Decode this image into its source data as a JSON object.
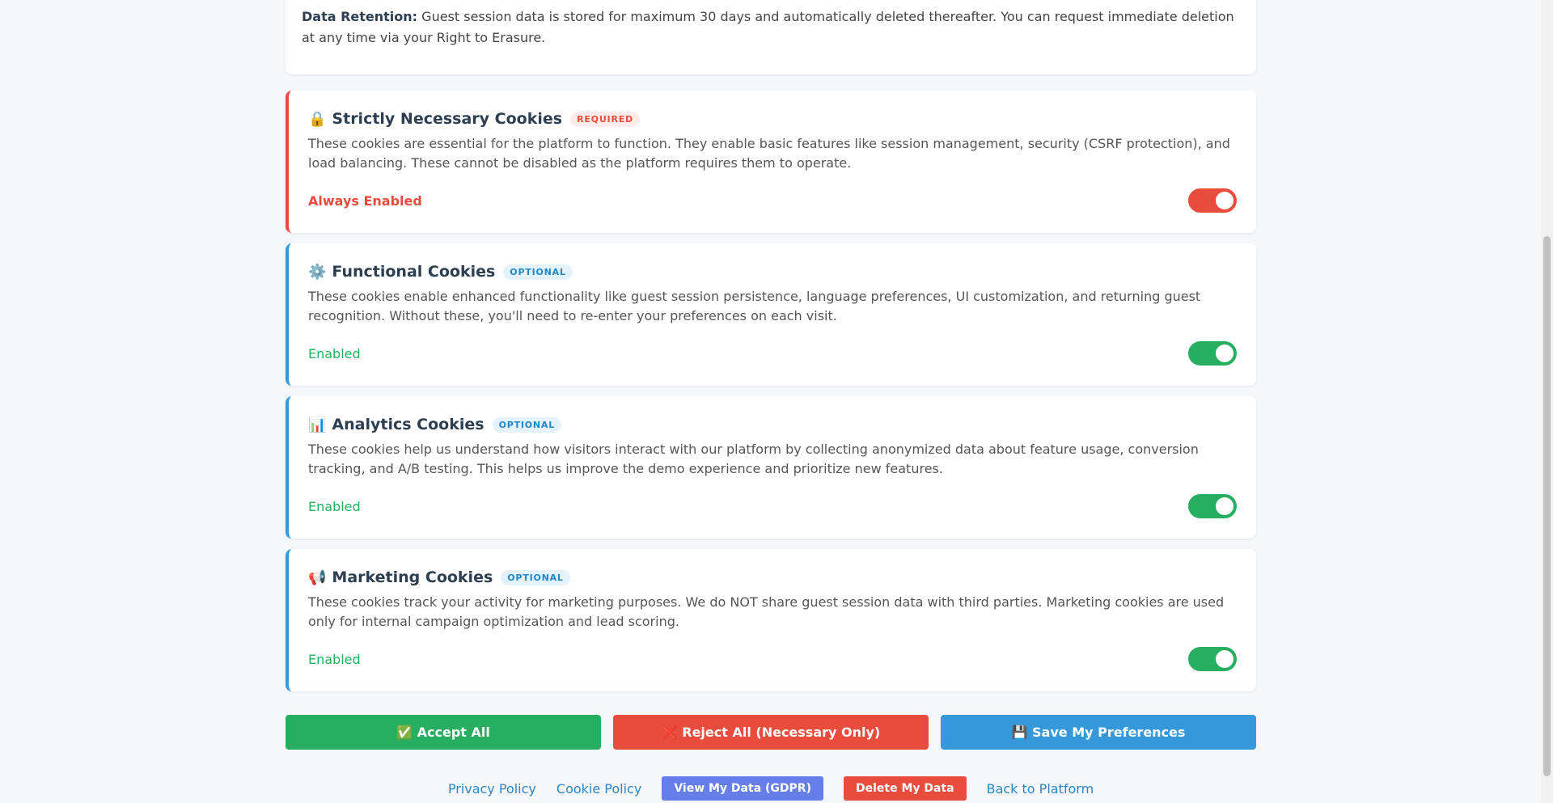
{
  "retention": {
    "label": "Data Retention:",
    "text": " Guest session data is stored for maximum 30 days and automatically deleted thereafter. You can request immediate deletion at any time via your Right to Erasure."
  },
  "cards": [
    {
      "icon": "🔒",
      "icon_name": "lock-icon",
      "title": "Strictly Necessary Cookies",
      "badge": "REQUIRED",
      "description": "These cookies are essential for the platform to function. They enable basic features like session management, security (CSRF protection), and load balancing. These cannot be disabled as the platform requires them to operate.",
      "status": "Always Enabled",
      "enabled": true
    },
    {
      "icon": "⚙️",
      "icon_name": "gear-icon",
      "title": "Functional Cookies",
      "badge": "OPTIONAL",
      "description": "These cookies enable enhanced functionality like guest session persistence, language preferences, UI customization, and returning guest recognition. Without these, you'll need to re-enter your preferences on each visit.",
      "status": "Enabled",
      "enabled": true
    },
    {
      "icon": "📊",
      "icon_name": "bar-chart-icon",
      "title": "Analytics Cookies",
      "badge": "OPTIONAL",
      "description": "These cookies help us understand how visitors interact with our platform by collecting anonymized data about feature usage, conversion tracking, and A/B testing. This helps us improve the demo experience and prioritize new features.",
      "status": "Enabled",
      "enabled": true
    },
    {
      "icon": "📢",
      "icon_name": "megaphone-icon",
      "title": "Marketing Cookies",
      "badge": "OPTIONAL",
      "description": "These cookies track your activity for marketing purposes. We do NOT share guest session data with third parties. Marketing cookies are used only for internal campaign optimization and lead scoring.",
      "status": "Enabled",
      "enabled": true
    }
  ],
  "actions": {
    "accept_all": "✅ Accept All",
    "reject_all": "❌ Reject All (Necessary Only)",
    "save": "💾 Save My Preferences"
  },
  "footer": {
    "privacy_policy": "Privacy Policy",
    "cookie_policy": "Cookie Policy",
    "view_data": "View My Data (GDPR)",
    "delete_data": "Delete My Data",
    "back": "Back to Platform"
  },
  "colors": {
    "required": "#e74c3c",
    "optional": "#3498db",
    "enabled": "#27ae60",
    "gdpr_button": "#667eea"
  }
}
